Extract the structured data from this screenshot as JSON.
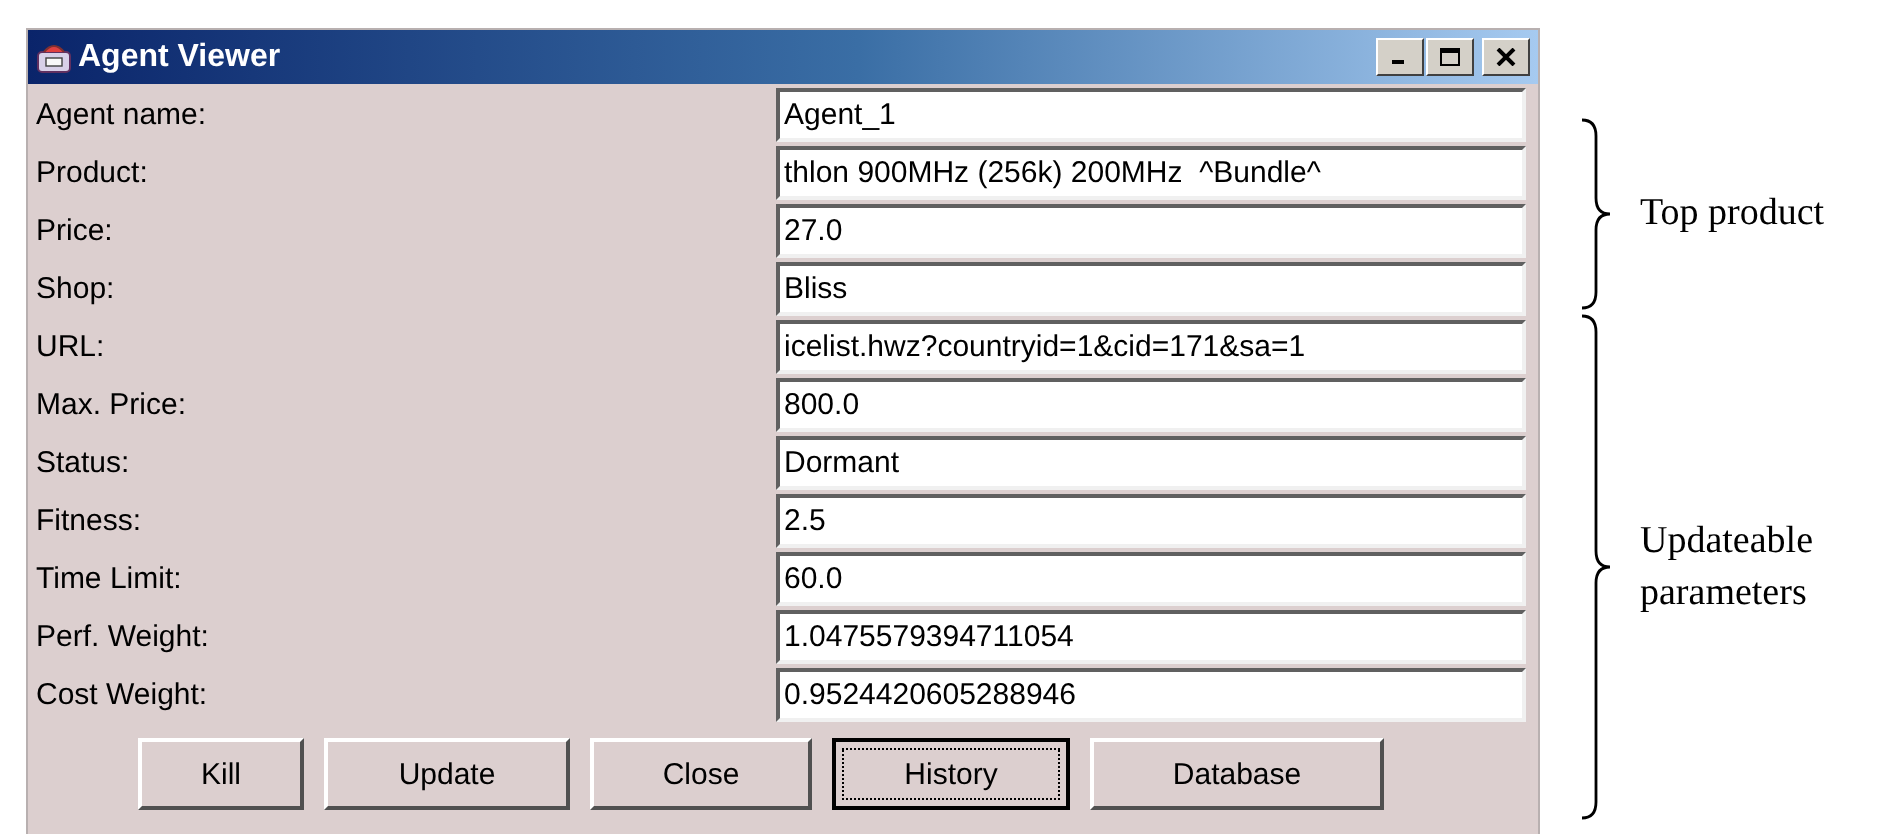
{
  "window": {
    "title": "Agent Viewer"
  },
  "fields": [
    {
      "label": "Agent name:",
      "value": "Agent_1"
    },
    {
      "label": "Product:",
      "value": "thlon 900MHz (256k) 200MHz  ^Bundle^"
    },
    {
      "label": "Price:",
      "value": "27.0"
    },
    {
      "label": "Shop:",
      "value": "Bliss"
    },
    {
      "label": "URL:",
      "value": "icelist.hwz?countryid=1&cid=171&sa=1"
    },
    {
      "label": "Max. Price:",
      "value": "800.0"
    },
    {
      "label": "Status:",
      "value": "Dormant"
    },
    {
      "label": "Fitness:",
      "value": "2.5"
    },
    {
      "label": "Time Limit:",
      "value": "60.0"
    },
    {
      "label": "Perf. Weight:",
      "value": "1.0475579394711054"
    },
    {
      "label": "Cost Weight:",
      "value": "0.9524420605288946"
    }
  ],
  "buttons": [
    {
      "label": "Kill",
      "focused": false
    },
    {
      "label": "Update",
      "focused": false
    },
    {
      "label": "Close",
      "focused": false
    },
    {
      "label": "History",
      "focused": true
    },
    {
      "label": "Database",
      "focused": false
    }
  ],
  "annotations": [
    {
      "text": "Top product"
    },
    {
      "text": "Updateable parameters"
    }
  ]
}
